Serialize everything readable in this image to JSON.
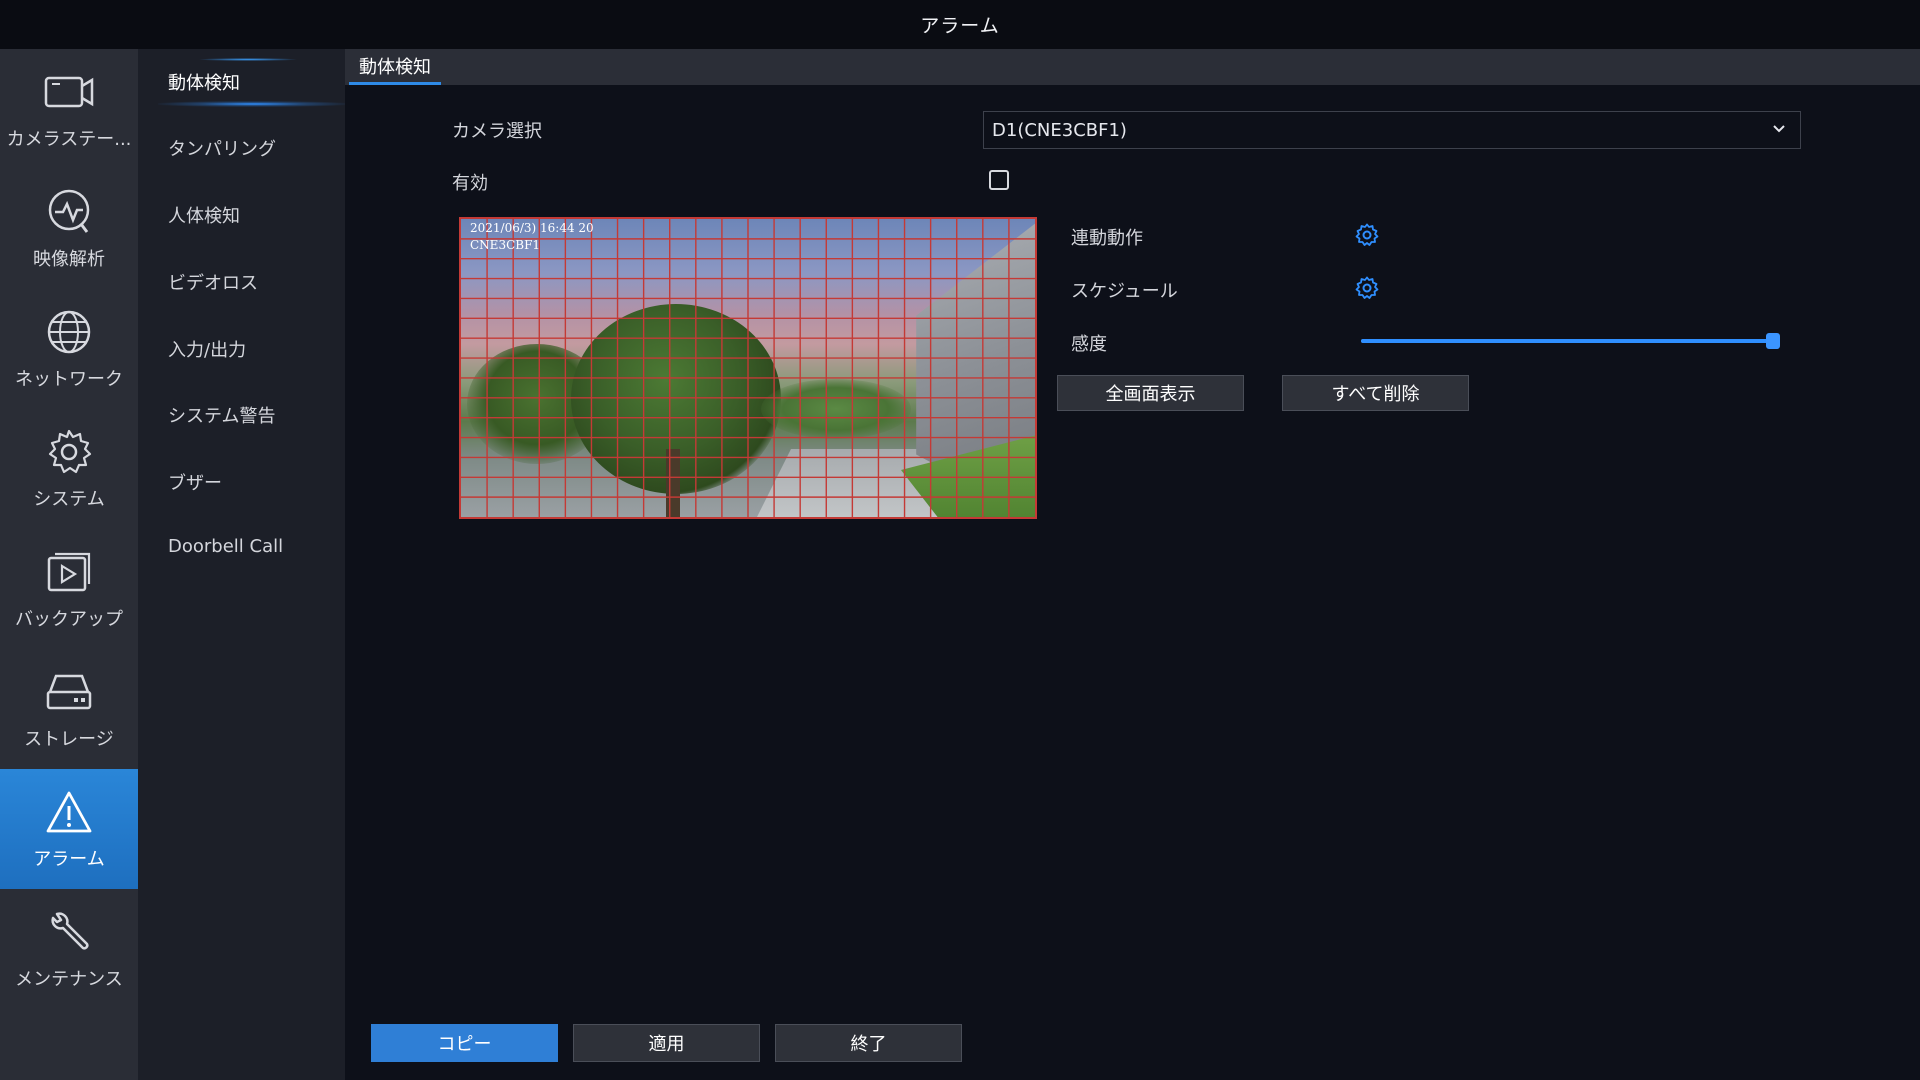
{
  "window": {
    "title": "アラーム"
  },
  "nav": {
    "items": [
      {
        "label": "カメラステー...",
        "icon": "camera-icon",
        "active": false
      },
      {
        "label": "映像解析",
        "icon": "analytics-icon",
        "active": false
      },
      {
        "label": "ネットワーク",
        "icon": "globe-icon",
        "active": false
      },
      {
        "label": "システム",
        "icon": "gear-icon",
        "active": false
      },
      {
        "label": "バックアップ",
        "icon": "play-backup-icon",
        "active": false
      },
      {
        "label": "ストレージ",
        "icon": "hdd-icon",
        "active": false
      },
      {
        "label": "アラーム",
        "icon": "warning-icon",
        "active": true
      },
      {
        "label": "メンテナンス",
        "icon": "wrench-icon",
        "active": false
      }
    ]
  },
  "subnav": {
    "items": [
      {
        "label": "動体検知",
        "active": true
      },
      {
        "label": "タンパリング",
        "active": false
      },
      {
        "label": "人体検知",
        "active": false
      },
      {
        "label": "ビデオロス",
        "active": false
      },
      {
        "label": "入力/出力",
        "active": false
      },
      {
        "label": "システム警告",
        "active": false
      },
      {
        "label": "ブザー",
        "active": false
      },
      {
        "label": "Doorbell Call",
        "active": false
      }
    ]
  },
  "tab": {
    "label": "動体検知"
  },
  "form": {
    "camera_label": "カメラ選択",
    "camera_value": "D1(CNE3CBF1)",
    "enable_label": "有効",
    "enable_checked": false,
    "linkage_label": "連動動作",
    "schedule_label": "スケジュール",
    "sensitivity_label": "感度",
    "sensitivity_value": 1.0,
    "fullscreen_button": "全画面表示",
    "clear_all_button": "すべて削除"
  },
  "preview": {
    "osd_time": "2021/06/3) 16:44 20",
    "osd_camera": "CNE3CBF1"
  },
  "footer": {
    "copy_button": "コピー",
    "apply_button": "適用",
    "exit_button": "終了"
  },
  "colors": {
    "accent": "#2f7fd6",
    "grid_line": "#c43a36"
  }
}
